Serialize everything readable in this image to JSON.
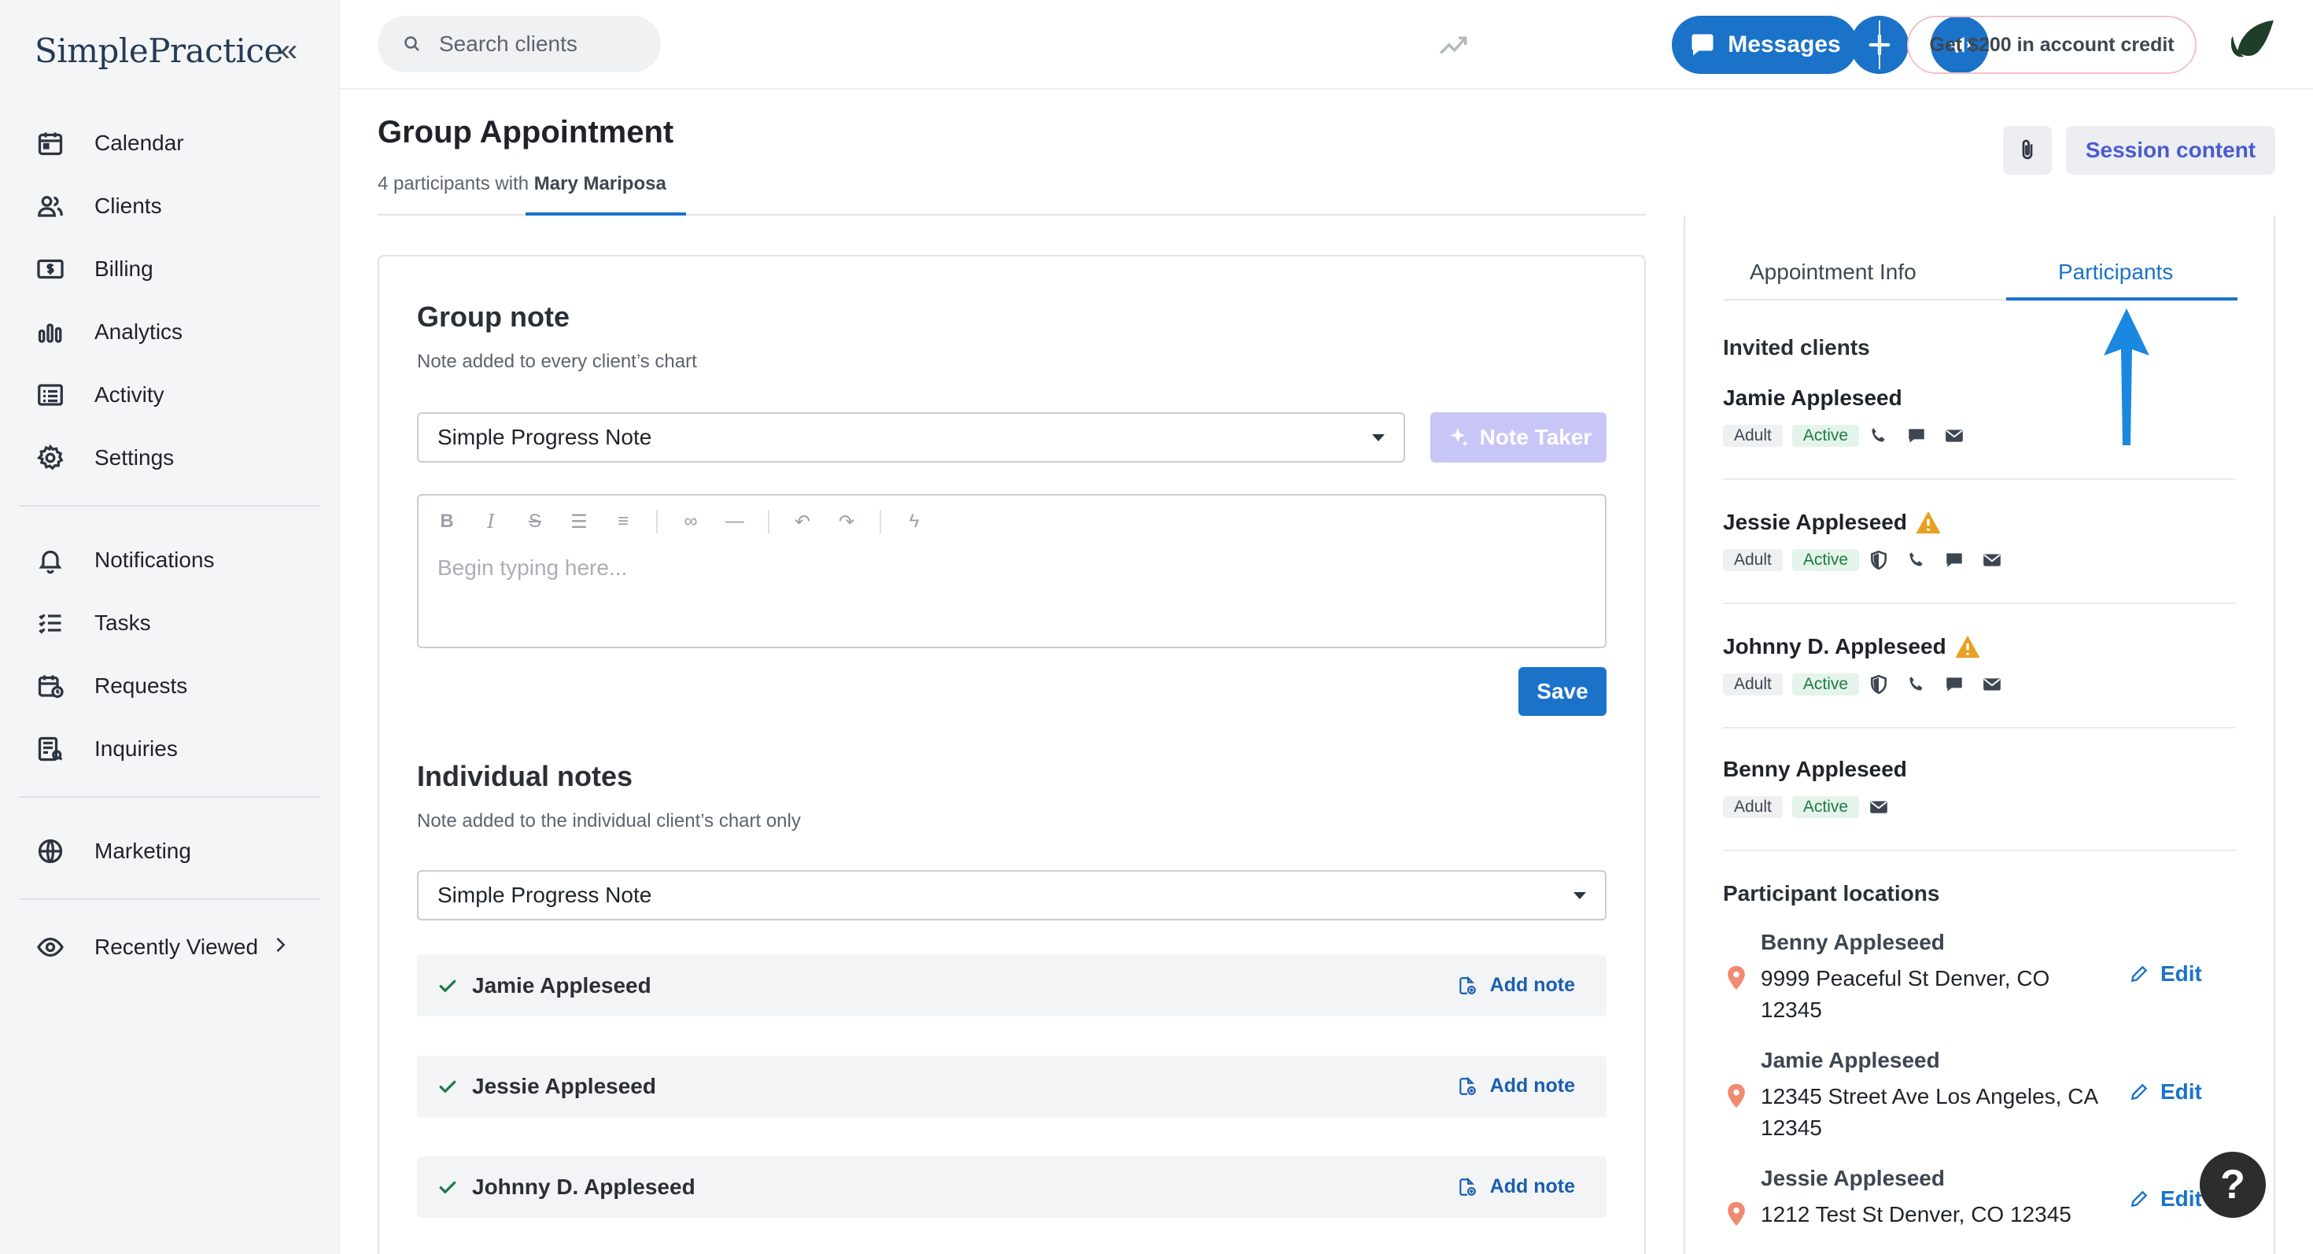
{
  "app": {
    "brand": "SimplePractice"
  },
  "sidebar": {
    "items": [
      {
        "label": "Calendar",
        "icon": "calendar-icon"
      },
      {
        "label": "Clients",
        "icon": "clients-icon"
      },
      {
        "label": "Billing",
        "icon": "billing-icon"
      },
      {
        "label": "Analytics",
        "icon": "analytics-icon"
      },
      {
        "label": "Activity",
        "icon": "activity-icon"
      },
      {
        "label": "Settings",
        "icon": "gear-icon"
      }
    ],
    "items2": [
      {
        "label": "Notifications",
        "icon": "bell-icon"
      },
      {
        "label": "Tasks",
        "icon": "tasks-icon"
      },
      {
        "label": "Requests",
        "icon": "requests-icon"
      },
      {
        "label": "Inquiries",
        "icon": "inquiries-icon"
      }
    ],
    "items3": [
      {
        "label": "Marketing",
        "icon": "globe-icon"
      }
    ],
    "recent": {
      "label": "Recently Viewed",
      "icon": "eye-icon"
    }
  },
  "topbar": {
    "search_placeholder": "Search clients",
    "messages_label": "Messages",
    "credit_label": "Get $200 in account credit"
  },
  "header": {
    "title": "Group Appointment",
    "subtitle_prefix": "4 participants with",
    "clinician": "Mary Mariposa",
    "session_content_label": "Session content"
  },
  "group_note": {
    "title": "Group note",
    "desc": "Note added to every client’s chart",
    "template": "Simple Progress Note",
    "note_taker_label": "Note Taker",
    "placeholder": "Begin typing here...",
    "save_label": "Save"
  },
  "individual_notes": {
    "title": "Individual notes",
    "desc": "Note added to the individual client’s chart only",
    "template": "Simple Progress Note",
    "add_note_label": "Add note",
    "clients": [
      "Jamie Appleseed",
      "Jessie Appleseed",
      "Johnny D. Appleseed"
    ]
  },
  "right_panel": {
    "tabs": {
      "info": "Appointment Info",
      "participants": "Participants"
    },
    "invited_heading": "Invited clients",
    "clients": [
      {
        "name": "Jamie Appleseed",
        "age": "Adult",
        "status": "Active"
      },
      {
        "name": "Jessie Appleseed",
        "age": "Adult",
        "status": "Active"
      },
      {
        "name": "Johnny D. Appleseed",
        "age": "Adult",
        "status": "Active"
      },
      {
        "name": "Benny Appleseed",
        "age": "Adult",
        "status": "Active"
      }
    ],
    "locations_heading": "Participant locations",
    "edit_label": "Edit",
    "locations": [
      {
        "name": "Benny Appleseed",
        "address": "9999 Peaceful St Denver, CO 12345"
      },
      {
        "name": "Jamie Appleseed",
        "address": "12345 Street Ave Los Angeles, CA 12345"
      },
      {
        "name": "Jessie Appleseed",
        "address": "1212 Test St Denver, CO 12345"
      }
    ]
  },
  "help_label": "?",
  "colors": {
    "primary": "#1a73c8",
    "accent_purple": "#4a5bd1",
    "active_green": "#1f7a45",
    "warning": "#e8a020"
  }
}
